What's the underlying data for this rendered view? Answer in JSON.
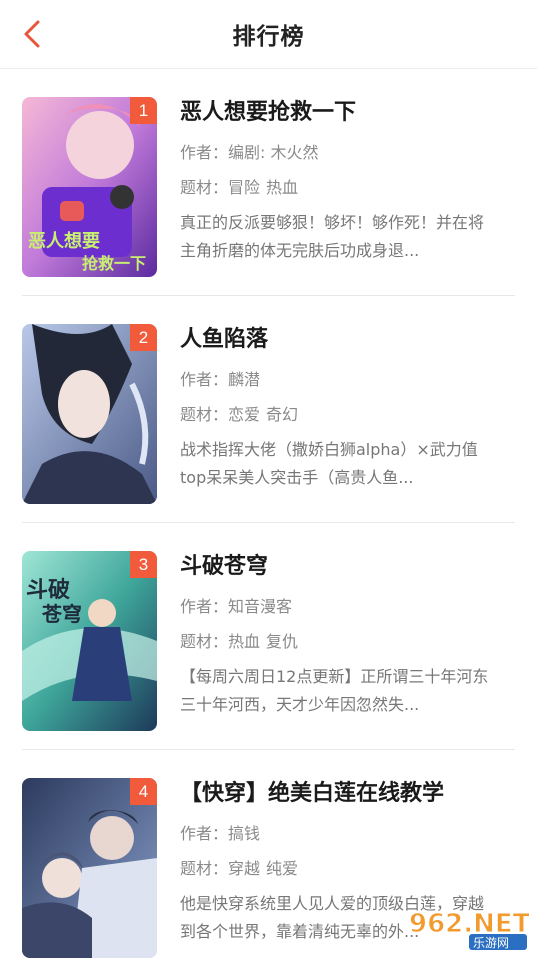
{
  "header": {
    "title": "排行榜",
    "back_icon": "chevron-left-icon"
  },
  "colors": {
    "accent": "#e9553a",
    "rank_badge": "#f25a3c"
  },
  "labels": {
    "author_prefix": "作者：",
    "genre_prefix": "题材："
  },
  "items": [
    {
      "rank": "1",
      "title": "恶人想要抢救一下",
      "author": "编剧: 木火然",
      "genres": [
        "冒险",
        "热血"
      ],
      "desc": "真正的反派要够狠！够坏！够作死！并在将主角折磨的体无完肤后功成身退..."
    },
    {
      "rank": "2",
      "title": "人鱼陷落",
      "author": "麟潜",
      "genres": [
        "恋爱",
        "奇幻"
      ],
      "desc": "战术指挥大佬（撒娇白狮alpha）×武力值top呆呆美人突击手（高贵人鱼..."
    },
    {
      "rank": "3",
      "title": "斗破苍穹",
      "author": "知音漫客",
      "genres": [
        "热血",
        "复仇"
      ],
      "desc": "【每周六周日12点更新】正所谓三十年河东三十年河西，天才少年因忽然失..."
    },
    {
      "rank": "4",
      "title": "【快穿】绝美白莲在线教学",
      "author": "搞钱",
      "genres": [
        "穿越",
        "纯爱"
      ],
      "desc": "他是快穿系统里人见人爱的顶级白莲，穿越到各个世界，靠着清纯无辜的外..."
    }
  ],
  "watermark": {
    "brand": "962.NET",
    "sub": "乐游网"
  }
}
